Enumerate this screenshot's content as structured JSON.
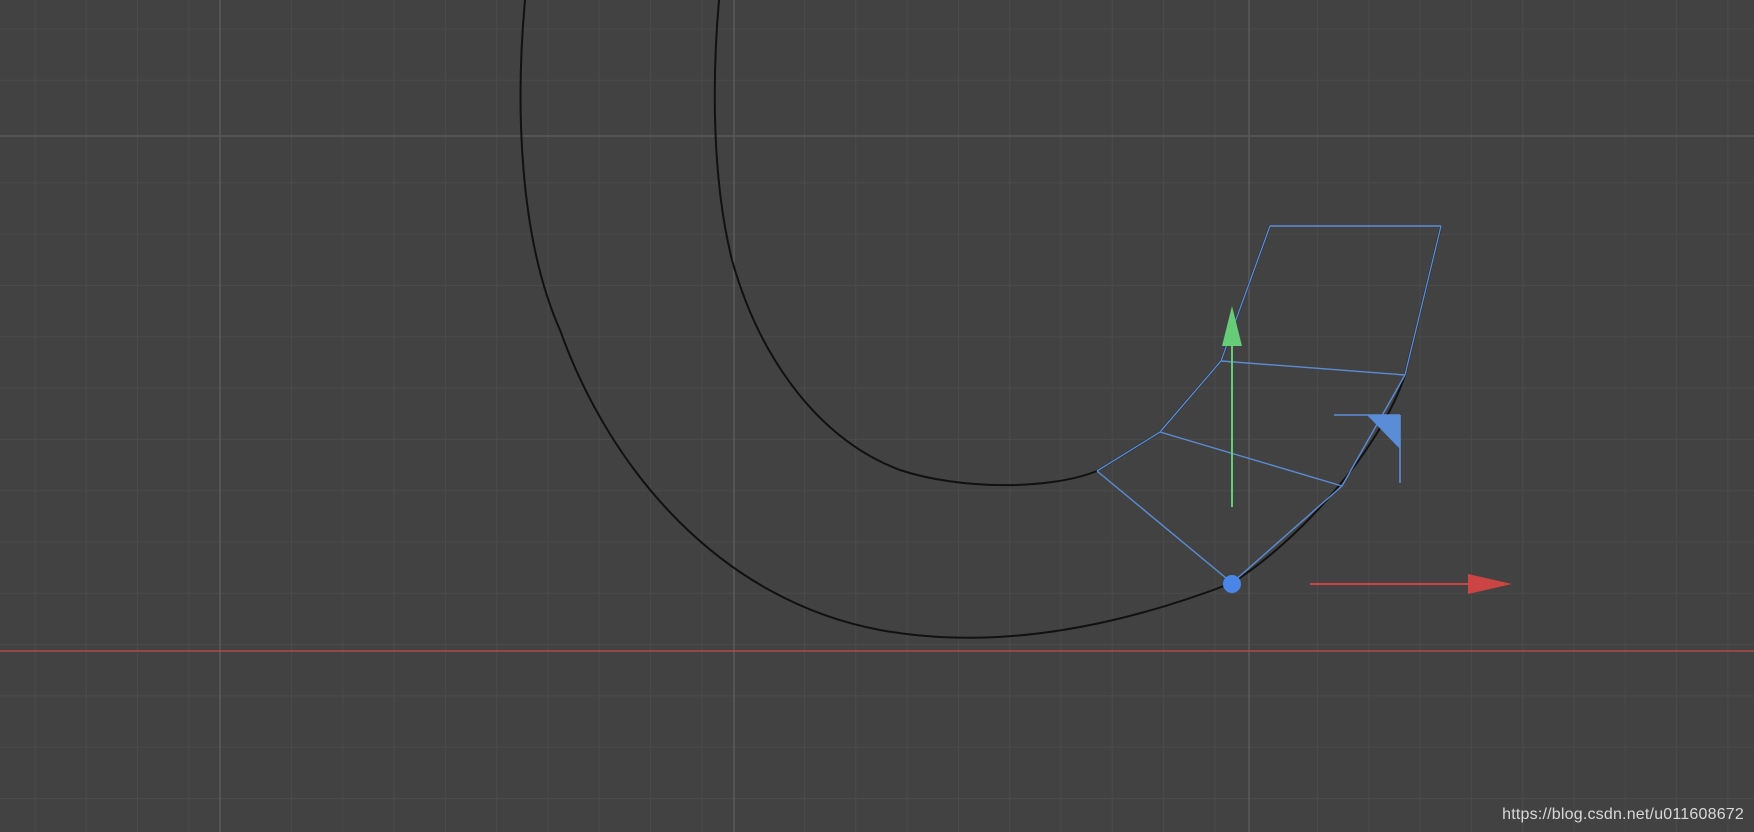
{
  "viewport": {
    "background": "#424242",
    "minor_grid_color": "#4b4b4b",
    "major_grid_color": "#5a5a5a",
    "x_axis_color": "#b04a44"
  },
  "mesh": {
    "outline_color": "#111111",
    "selection_color": "#5b8dd6"
  },
  "gizmo": {
    "y_axis_color": "#66cc77",
    "x_axis_color": "#cc4444",
    "origin_color": "#4a86e8",
    "icons": [
      "move-y-arrow-icon",
      "move-x-arrow-icon",
      "xy-plane-handle-icon",
      "pivot-point-icon"
    ]
  },
  "watermark": {
    "text": "https://blog.csdn.net/u011608672"
  }
}
